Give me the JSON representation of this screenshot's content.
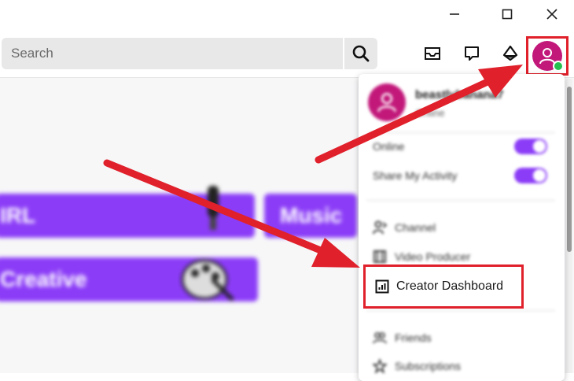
{
  "window_controls": {
    "minimize": "minimize-icon",
    "maximize": "maximize-icon",
    "close": "close-icon"
  },
  "search": {
    "placeholder": "Search"
  },
  "header_icons": [
    "inbox-icon",
    "whispers-icon",
    "bits-icon"
  ],
  "user": {
    "username": "beastlybanana7",
    "status": "Online"
  },
  "menu": {
    "toggles": [
      {
        "label": "Online",
        "on": true
      },
      {
        "label": "Share My Activity",
        "on": true
      }
    ],
    "items": [
      {
        "label": "Channel",
        "icon": "channel-icon"
      },
      {
        "label": "Video Producer",
        "icon": "video-producer-icon"
      },
      {
        "label": "Creator Dashboard",
        "icon": "dashboard-icon"
      },
      {
        "label": "Friends",
        "icon": "friends-icon"
      },
      {
        "label": "Subscriptions",
        "icon": "subscriptions-icon"
      }
    ]
  },
  "categories": [
    {
      "label": "IRL"
    },
    {
      "label": "Music"
    },
    {
      "label": "Creative"
    }
  ],
  "colors": {
    "accent": "#8b3cf7",
    "avatar": "#c2187a",
    "highlight": "#e0202b",
    "online": "#25c04f"
  }
}
